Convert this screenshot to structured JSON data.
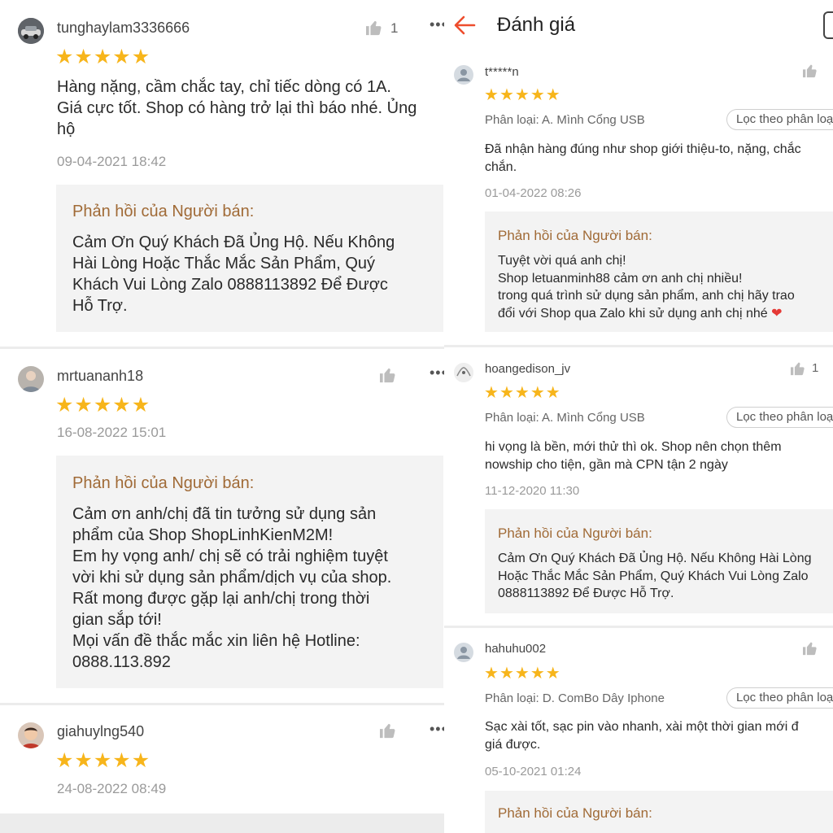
{
  "header": {
    "title": "Đánh giá"
  },
  "left_reviews": [
    {
      "username": "tunghaylam3336666",
      "like_count": "1",
      "content_lines": [
        "Hàng nặng, cầm chắc tay, chỉ tiếc dòng có 1A.",
        "Giá cực tốt. Shop có hàng trở lại thì báo nhé. Ủng",
        "hộ"
      ],
      "date": "09-04-2021 18:42",
      "reply": {
        "title": "Phản hồi của Người bán:",
        "lines": [
          "Cảm Ơn Quý Khách Đã Ủng Hộ. Nếu Không",
          "Hài Lòng Hoặc Thắc Mắc Sản Phẩm, Quý",
          "Khách Vui Lòng Zalo 0888113892 Để Được",
          "Hỗ Trợ."
        ]
      }
    },
    {
      "username": "mrtuananh18",
      "date": "16-08-2022 15:01",
      "reply": {
        "title": "Phản hồi của Người bán:",
        "lines": [
          "Cảm ơn anh/chị đã tin tưởng sử dụng sản",
          "phẩm của Shop ShopLinhKienM2M!",
          "Em hy vọng anh/ chị sẽ có trải nghiệm tuyệt",
          "vời khi sử dụng sản phẩm/dịch vụ của shop.",
          "Rất mong được gặp lại anh/chị trong thời",
          "gian sắp tới!",
          "Mọi vấn đề thắc mắc xin liên hệ Hotline:",
          "0888.113.892"
        ]
      }
    },
    {
      "username": "giahuylng540",
      "date": "24-08-2022 08:49"
    }
  ],
  "right_reviews": [
    {
      "username": "t*****n",
      "variant": "Phân loại: A. Mình Cổng USB",
      "filter_label": "Lọc theo phân loại",
      "content_lines": [
        "Đã nhận hàng đúng như shop giới thiệu-to, nặng, chắc",
        "chắn."
      ],
      "date": "01-04-2022 08:26",
      "reply": {
        "title": "Phản hồi của Người bán:",
        "lines": [
          "Tuyệt vời quá anh chị!",
          "Shop letuanminh88 cảm ơn anh chị nhiều!",
          "trong quá trình sử dụng sản phẩm, anh chị hãy trao",
          "đổi với Shop qua Zalo khi sử dụng anh chị nhé"
        ],
        "heart": "❤"
      }
    },
    {
      "username": "hoangedison_jv",
      "like_count": "1",
      "variant": "Phân loại: A. Mình Cổng USB",
      "filter_label": "Lọc theo phân loại",
      "content_lines": [
        "hi vọng là bền, mới thử thì ok. Shop nên chọn thêm",
        "nowship cho tiện, gần mà CPN tận 2 ngày"
      ],
      "date": "11-12-2020 11:30",
      "reply": {
        "title": "Phản hồi của Người bán:",
        "lines": [
          "Cảm Ơn Quý Khách Đã Ủng Hộ. Nếu Không Hài Lòng",
          "Hoặc Thắc Mắc Sản Phẩm, Quý Khách Vui Lòng Zalo",
          "0888113892 Để Được Hỗ Trợ."
        ]
      }
    },
    {
      "username": "hahuhu002",
      "variant": "Phân loại: D. ComBo Dây Iphone",
      "filter_label": "Lọc theo phân loại",
      "content_lines": [
        "Sạc xài tốt, sạc pin vào nhanh, xài một thời gian mới đ",
        "giá được."
      ],
      "date": "05-10-2021 01:24",
      "reply": {
        "title": "Phản hồi của Người bán:"
      }
    }
  ],
  "icons": {
    "back": "arrow-left-icon",
    "like": "thumbs-up-icon",
    "more": "more-options-icon",
    "star": "star-icon",
    "avatar": "user-avatar-icon"
  },
  "colors": {
    "star": "#f7b51b",
    "reply_title": "#a06a36",
    "back_arrow": "#ee4d2d",
    "reply_bg": "#f3f3f3"
  }
}
